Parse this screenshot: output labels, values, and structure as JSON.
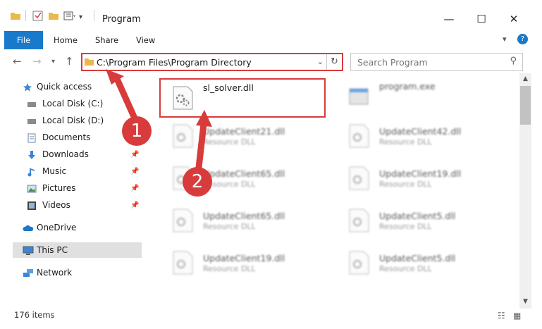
{
  "window": {
    "title": "Program",
    "controls": {
      "minimize": "—",
      "maximize": "☐",
      "close": "✕"
    }
  },
  "ribbon": {
    "tabs": [
      {
        "label": "File"
      },
      {
        "label": "Home"
      },
      {
        "label": "Share"
      },
      {
        "label": "View"
      }
    ]
  },
  "address": {
    "path": "C:\\Program Files\\Program Directory"
  },
  "search": {
    "placeholder": "Search Program"
  },
  "sidebar": {
    "items": [
      {
        "label": "Quick access",
        "icon": "star-icon"
      },
      {
        "label": "Local Disk (C:)",
        "icon": "drive-icon"
      },
      {
        "label": "Local Disk (D:)",
        "icon": "drive-icon"
      },
      {
        "label": "Documents",
        "icon": "documents-icon"
      },
      {
        "label": "Downloads",
        "icon": "download-icon",
        "pinned": true
      },
      {
        "label": "Music",
        "icon": "music-icon",
        "pinned": true
      },
      {
        "label": "Pictures",
        "icon": "pictures-icon",
        "pinned": true
      },
      {
        "label": "Videos",
        "icon": "videos-icon",
        "pinned": true
      },
      {
        "label": "OneDrive",
        "icon": "cloud-icon"
      },
      {
        "label": "This PC",
        "icon": "computer-icon",
        "selected": true
      },
      {
        "label": "Network",
        "icon": "network-icon"
      }
    ]
  },
  "files": [
    {
      "name": "sl_solver.dll",
      "type": ""
    },
    {
      "name": "program.exe",
      "type": ""
    },
    {
      "name": "UpdateClient21.dll",
      "type": "Resource DLL"
    },
    {
      "name": "UpdateClient42.dll",
      "type": "Resource DLL"
    },
    {
      "name": "UpdateClient65.dll",
      "type": "Resource DLL"
    },
    {
      "name": "UpdateClient19.dll",
      "type": "Resource DLL"
    },
    {
      "name": "UpdateClient65.dll",
      "type": "Resource DLL"
    },
    {
      "name": "UpdateClient5.dll",
      "type": "Resource DLL"
    },
    {
      "name": "UpdateClient19.dll",
      "type": "Resource DLL"
    },
    {
      "name": "UpdateClient5.dll",
      "type": "Resource DLL"
    }
  ],
  "status": {
    "item_count": "176 items"
  },
  "annotations": {
    "step1": "1",
    "step2": "2",
    "color": "#d83b3b"
  }
}
